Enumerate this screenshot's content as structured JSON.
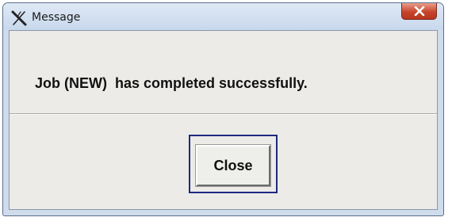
{
  "window": {
    "title": "Message",
    "app_icon": "x-logo-icon",
    "close_icon": "close-icon"
  },
  "dialog": {
    "message": "Job (NEW)  has completed successfully.",
    "close_button_label": "Close"
  },
  "colors": {
    "close_button_red": "#c8452c",
    "client_background": "#ecebe7",
    "focus_ring": "#1d2a80"
  }
}
